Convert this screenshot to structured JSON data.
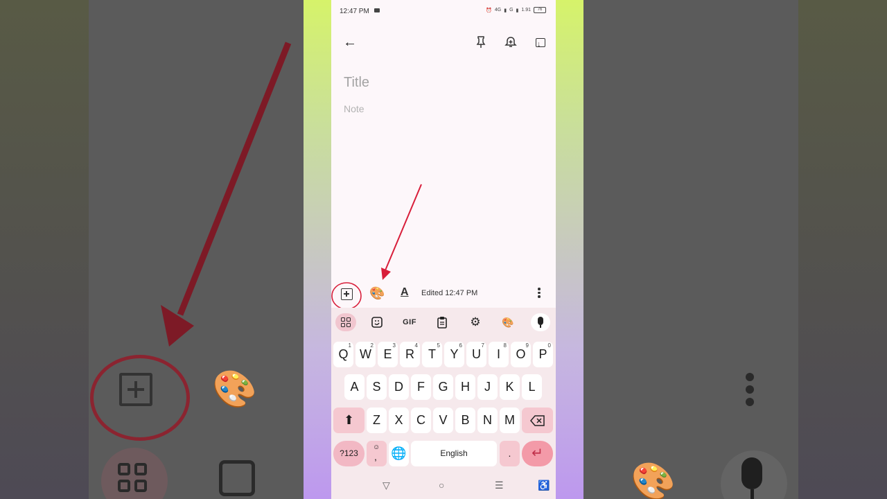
{
  "status_bar": {
    "time": "12:47 PM",
    "net1": "4G",
    "net2": "G",
    "speed": "1.91",
    "battery": "76"
  },
  "toolbar": {
    "back_icon": "arrow-back-icon",
    "pin_icon": "pin-icon",
    "reminder_icon": "bell-plus-icon",
    "archive_icon": "archive-icon"
  },
  "note": {
    "title_placeholder": "Title",
    "body_placeholder": "Note"
  },
  "edit_bar": {
    "edited_label": "Edited 12:47 PM"
  },
  "keyboard": {
    "toolbar": {
      "gif_label": "GIF"
    },
    "row1": [
      {
        "label": "Q",
        "hint": "1"
      },
      {
        "label": "W",
        "hint": "2"
      },
      {
        "label": "E",
        "hint": "3"
      },
      {
        "label": "R",
        "hint": "4"
      },
      {
        "label": "T",
        "hint": "5"
      },
      {
        "label": "Y",
        "hint": "6"
      },
      {
        "label": "U",
        "hint": "7"
      },
      {
        "label": "I",
        "hint": "8"
      },
      {
        "label": "O",
        "hint": "9"
      },
      {
        "label": "P",
        "hint": "0"
      }
    ],
    "row2": [
      "A",
      "S",
      "D",
      "F",
      "G",
      "H",
      "J",
      "K",
      "L"
    ],
    "row3": [
      "Z",
      "X",
      "C",
      "V",
      "B",
      "N",
      "M"
    ],
    "symbols_label": "?123",
    "comma_label": ",",
    "space_label": "English",
    "period_label": "."
  },
  "colors": {
    "accent_red": "#d81e3a",
    "keyboard_bg": "#f6e9ec",
    "key_pink": "#f5c8d0"
  }
}
